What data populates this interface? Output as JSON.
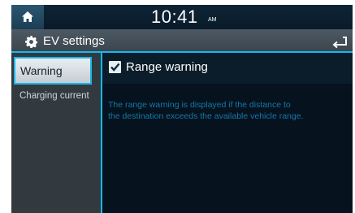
{
  "status_bar": {
    "time": "10:41",
    "ampm": "AM"
  },
  "header": {
    "title": "EV settings"
  },
  "sidebar": {
    "items": [
      {
        "label": "Warning",
        "selected": true
      },
      {
        "label": "Charging current",
        "selected": false
      }
    ]
  },
  "main": {
    "option": {
      "label": "Range warning",
      "checked": true
    },
    "description": "The range warning is displayed if the distance to the destination exceeds the available vehicle range."
  },
  "colors": {
    "accent": "#13b9ee",
    "background": "#06121e",
    "sidebar": "#333a3f",
    "description_text": "#1478a8"
  },
  "icons": [
    "home-icon",
    "settings-gear-icon",
    "back-arrow-icon",
    "checkmark-icon"
  ]
}
